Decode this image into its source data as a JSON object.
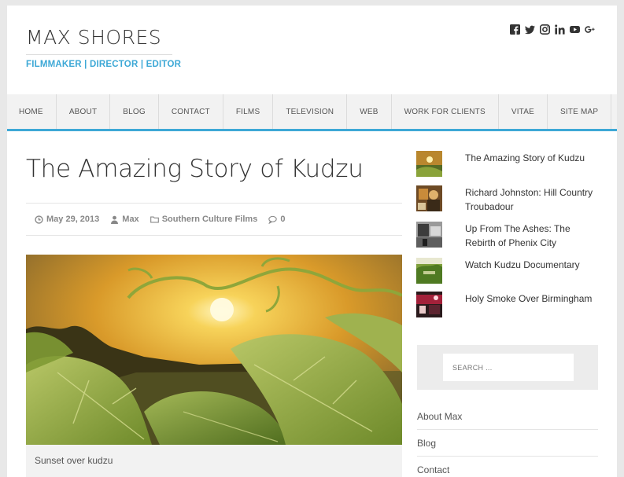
{
  "site": {
    "title": "MAX SHORES",
    "tagline": "FILMMAKER | DIRECTOR | EDITOR"
  },
  "social": [
    {
      "icon": "facebook-icon"
    },
    {
      "icon": "twitter-icon"
    },
    {
      "icon": "instagram-icon"
    },
    {
      "icon": "linkedin-icon"
    },
    {
      "icon": "youtube-icon"
    },
    {
      "icon": "google-plus-icon"
    }
  ],
  "nav": {
    "items": [
      "HOME",
      "ABOUT",
      "BLOG",
      "CONTACT",
      "FILMS",
      "TELEVISION",
      "WEB",
      "WORK FOR CLIENTS",
      "VITAE",
      "SITE MAP"
    ]
  },
  "post": {
    "title": "The Amazing Story of Kudzu",
    "date": "May 29, 2013",
    "author": "Max",
    "category": "Southern Culture Films",
    "comments": "0",
    "image_caption": "Sunset over kudzu"
  },
  "sidebar": {
    "recent_posts": [
      {
        "title": "The Amazing Story of Kudzu"
      },
      {
        "title": "Richard Johnston: Hill Country Troubadour"
      },
      {
        "title": "Up From The Ashes: The Rebirth of Phenix City"
      },
      {
        "title": "Watch Kudzu Documentary"
      },
      {
        "title": "Holy Smoke Over Birmingham"
      }
    ],
    "search": {
      "placeholder": "SEARCH ..."
    },
    "pages": [
      "About Max",
      "Blog",
      "Contact"
    ]
  },
  "colors": {
    "accent": "#3da8d6",
    "nav_bg": "#f2f2f2",
    "page_bg": "#e8e8e8"
  }
}
